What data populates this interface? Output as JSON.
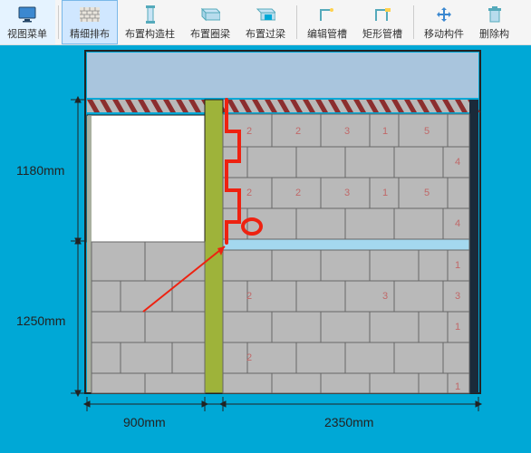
{
  "toolbar": {
    "view_menu": "视图菜单",
    "fine_layout": "精细排布",
    "struct_column": "布置构造柱",
    "ring_beam": "布置圈梁",
    "lintel": "布置过梁",
    "edit_groove": "编辑管槽",
    "rect_groove": "矩形管槽",
    "move_part": "移动构件",
    "delete": "删除构"
  },
  "dims": {
    "h1": "1180mm",
    "h2": "1250mm",
    "w1": "900mm",
    "w2": "2350mm"
  },
  "bricks": {
    "row1": [
      "2",
      "2",
      "3",
      "1",
      "5"
    ],
    "row1b": "4",
    "row2": [
      "2",
      "2",
      "3",
      "1",
      "5"
    ],
    "row2b": "4",
    "row3": [
      "1",
      "1"
    ],
    "row4": [
      "2",
      "3",
      "3"
    ],
    "row5": [
      "2",
      "1"
    ]
  }
}
